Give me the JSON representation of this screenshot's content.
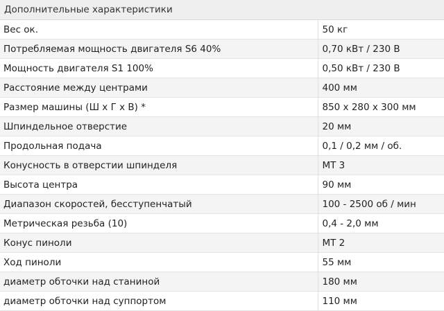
{
  "section": {
    "title": "Дополнительные характеристики"
  },
  "rows": [
    {
      "label": "Вес ок.",
      "value": "50 кг"
    },
    {
      "label": "Потребляемая мощность двигателя S6 40%",
      "value": "0,70 кВт / 230 В"
    },
    {
      "label": "Мощность двигателя S1 100%",
      "value": "0,50 кВт / 230 В"
    },
    {
      "label": "Расстояние между центрами",
      "value": "400 мм"
    },
    {
      "label": "Размер машины (Ш x Г x В) *",
      "value": "850 x 280 x 300 мм"
    },
    {
      "label": "Шпиндельное отверстие",
      "value": "20 мм"
    },
    {
      "label": "Продольная подача",
      "value": "0,1 / 0,2 мм / об."
    },
    {
      "label": "Конусность в отверстии шпинделя",
      "value": "MT 3"
    },
    {
      "label": "Высота центра",
      "value": "90 мм"
    },
    {
      "label": "Диапазон скоростей, бесступенчатый",
      "value": "100 - 2500 об / мин"
    },
    {
      "label": "Метрическая резьба (10)",
      "value": "0,4 - 2,0 мм"
    },
    {
      "label": "Конус пиноли",
      "value": "MT 2"
    },
    {
      "label": "Ход пиноли",
      "value": "55 мм"
    },
    {
      "label": "диаметр обточки над станиной",
      "value": "180 мм"
    },
    {
      "label": "диаметр обточки над суппортом",
      "value": "110 мм"
    }
  ]
}
